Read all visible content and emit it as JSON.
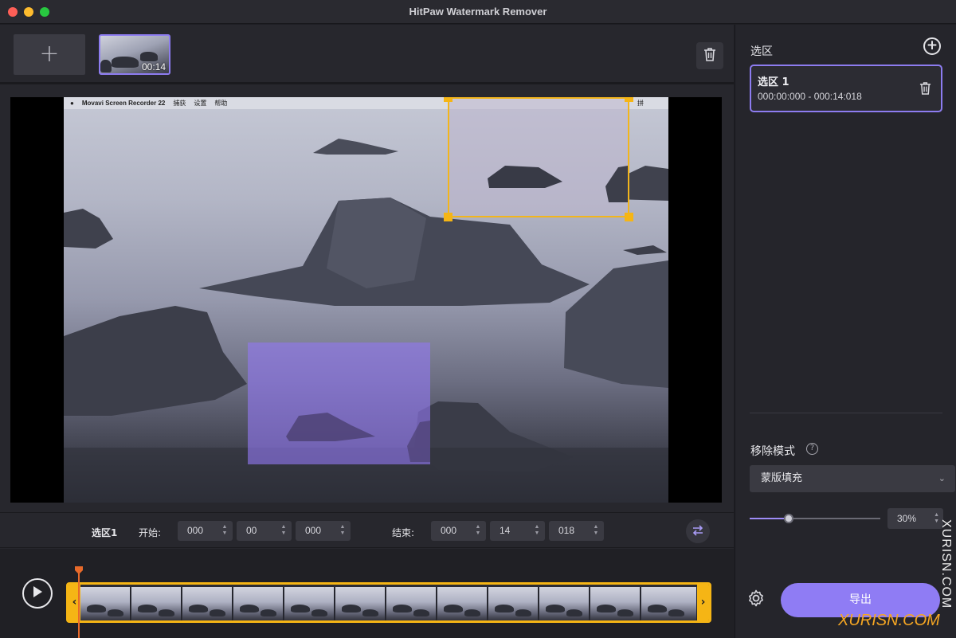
{
  "app": {
    "title": "HitPaw Watermark Remover"
  },
  "media": {
    "add_label": "+",
    "thumbnail_duration": "00:14"
  },
  "menubar": {
    "app_name": "Movavi Screen Recorder 22",
    "items": [
      "捕获",
      "设置",
      "帮助"
    ],
    "input_badge": "拼"
  },
  "controls": {
    "selection_label": "选区1",
    "start_label": "开始:",
    "start": {
      "h": "000",
      "m": "00",
      "ms": "000"
    },
    "end_label": "结束:",
    "end": {
      "h": "000",
      "m": "14",
      "ms": "018"
    }
  },
  "sidebar": {
    "title": "选区",
    "selections": [
      {
        "name": "选区 1",
        "range": "000:00:000 - 000:14:018"
      }
    ],
    "mode_label": "移除模式",
    "mode_value": "蒙版填充",
    "opacity_percent": 30,
    "opacity_text": "30%",
    "export_label": "导出"
  },
  "watermarks": {
    "vertical": "XURISN.COM",
    "bottom": "XURISN.COM"
  },
  "colors": {
    "accent": "#8f7cf4",
    "selection_handle": "#f5b515",
    "playhead": "#e86a2a",
    "background": "#1e1e23"
  }
}
